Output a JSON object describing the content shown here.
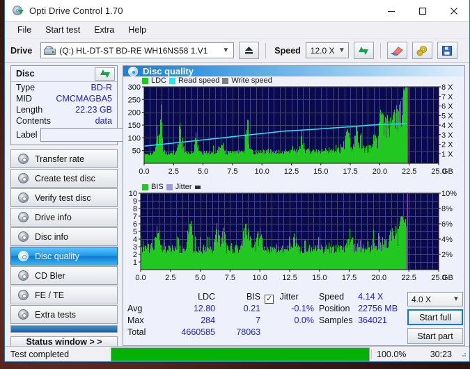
{
  "window": {
    "title": "Opti Drive Control 1.70",
    "app_icon": "disc-arrow-icon",
    "controls": {
      "minimize": "minimize-icon",
      "maximize": "maximize-icon",
      "close": "close-icon"
    }
  },
  "menu": {
    "items": [
      "File",
      "Start test",
      "Extra",
      "Help"
    ]
  },
  "toolbar": {
    "drive_label": "Drive",
    "drive_value": "(Q:)  HL-DT-ST BD-RE  WH16NS58 1.V1",
    "eject_icon": "eject-icon",
    "speed_label": "Speed",
    "speed_value": "12.0 X",
    "refresh_icon": "refresh-icon",
    "erase_icon": "eraser-icon",
    "settings_icon": "gear-icon",
    "save_icon": "save-icon"
  },
  "disc_panel": {
    "title": "Disc",
    "refresh_icon": "refresh-icon",
    "rows": [
      {
        "key": "Type",
        "value": "BD-R"
      },
      {
        "key": "MID",
        "value": "CMCMAGBA5"
      },
      {
        "key": "Length",
        "value": "22.23 GB"
      },
      {
        "key": "Contents",
        "value": "data"
      }
    ],
    "label_key": "Label",
    "label_value": "",
    "label_placeholder": "",
    "eject_disc_icon": "cd-icon"
  },
  "nav": {
    "items": [
      {
        "label": "Transfer rate",
        "icon": "disc-icon",
        "selected": false
      },
      {
        "label": "Create test disc",
        "icon": "disc-icon",
        "selected": false
      },
      {
        "label": "Verify test disc",
        "icon": "disc-icon",
        "selected": false
      },
      {
        "label": "Drive info",
        "icon": "disc-icon",
        "selected": false
      },
      {
        "label": "Disc info",
        "icon": "disc-icon",
        "selected": false
      },
      {
        "label": "Disc quality",
        "icon": "disc-icon",
        "selected": true
      },
      {
        "label": "CD Bler",
        "icon": "disc-icon",
        "selected": false
      },
      {
        "label": "FE / TE",
        "icon": "disc-icon",
        "selected": false
      },
      {
        "label": "Extra tests",
        "icon": "disc-icon",
        "selected": false
      }
    ],
    "status_window_button": "Status window > >"
  },
  "quality_panel": {
    "title": "Disc quality",
    "icon": "disc-icon"
  },
  "stats": {
    "col_headers": [
      "LDC",
      "BIS"
    ],
    "row_labels": [
      "Avg",
      "Max",
      "Total"
    ],
    "ldc": {
      "avg": "12.80",
      "max": "284",
      "total": "4660585"
    },
    "bis": {
      "avg": "0.21",
      "max": "7",
      "total": "78063"
    },
    "jitter": {
      "label": "Jitter",
      "checked": true,
      "check_glyph": "✓",
      "avg": "-0.1%",
      "max": "0.0%"
    },
    "speed_label": "Speed",
    "speed_value": "4.14 X",
    "position_label": "Position",
    "position_value": "22756 MB",
    "samples_label": "Samples",
    "samples_value": "364021",
    "result_speed": "4.0 X",
    "start_full": "Start full",
    "start_part": "Start part"
  },
  "statusbar": {
    "text": "Test completed",
    "progress_percent": 100.0,
    "progress_label": "100.0%",
    "elapsed": "30:23"
  },
  "colors": {
    "ldc_green": "#22c722",
    "read_speed_cyan": "#25e6f0",
    "write_speed_gray": "#808080",
    "bis_green": "#22c722",
    "jitter_lilac": "#9a9aea",
    "plot_bg": "#0a0a52",
    "grid": "#46466e",
    "marker_magenta": "#e020b0",
    "title_blue": "#1e7fd4",
    "value_blue": "#1c1ccc",
    "progress_green": "#06b006"
  },
  "chart_data": [
    {
      "type": "area",
      "name": "ldc-chart",
      "title": "",
      "xlabel": "GB",
      "ylabel": "LDC",
      "xlim": [
        0.0,
        25.0
      ],
      "ylim": [
        0,
        300
      ],
      "xticks": [
        "0.0",
        "2.5",
        "5.0",
        "7.5",
        "10.0",
        "12.5",
        "15.0",
        "17.5",
        "20.0",
        "22.5",
        "25.0"
      ],
      "yticks": [
        "50",
        "100",
        "150",
        "200",
        "250",
        "300"
      ],
      "y2ticks": [
        "1 X",
        "2 X",
        "3 X",
        "4 X",
        "5 X",
        "6 X",
        "7 X",
        "8 X"
      ],
      "y2lim": [
        0,
        8
      ],
      "grid": true,
      "legend": [
        {
          "name": "LDC",
          "color": "#22c722"
        },
        {
          "name": "Read speed",
          "color": "#25e6f0"
        },
        {
          "name": "Write speed",
          "color": "#808080"
        }
      ],
      "data_end_gb": 22.3,
      "series": [
        {
          "name": "LDC",
          "kind": "area",
          "x": [
            0.0,
            0.3,
            0.6,
            0.9,
            1.05,
            1.15,
            1.2,
            1.35,
            1.45,
            1.5,
            1.6,
            1.8,
            2.1,
            2.4,
            2.7,
            3.0,
            3.3,
            3.45,
            3.6,
            3.9,
            4.2,
            4.4,
            4.45,
            4.6,
            4.9,
            5.2,
            5.5,
            5.8,
            6.1,
            6.4,
            6.7,
            6.75,
            7.0,
            7.3,
            7.6,
            7.9,
            8.2,
            8.5,
            8.8,
            8.9,
            9.0,
            9.3,
            9.6,
            9.9,
            10.2,
            10.5,
            10.8,
            11.1,
            11.4,
            11.7,
            12.0,
            12.3,
            12.6,
            12.9,
            13.2,
            13.35,
            13.6,
            13.9,
            14.2,
            14.5,
            14.8,
            15.1,
            15.4,
            15.7,
            16.0,
            16.3,
            16.6,
            16.9,
            17.2,
            17.3,
            17.45,
            17.55,
            17.7,
            18.0,
            18.2,
            18.35,
            18.6,
            18.9,
            19.2,
            19.5,
            19.8,
            20.0,
            20.3,
            20.6,
            20.9,
            21.2,
            21.5,
            21.8,
            22.0,
            22.15,
            22.3
          ],
          "y": [
            38,
            40,
            42,
            45,
            160,
            95,
            80,
            205,
            243,
            120,
            70,
            48,
            45,
            44,
            46,
            163,
            48,
            45,
            47,
            45,
            46,
            182,
            70,
            48,
            46,
            45,
            47,
            48,
            50,
            48,
            100,
            52,
            49,
            47,
            46,
            48,
            50,
            52,
            196,
            90,
            55,
            50,
            49,
            48,
            50,
            52,
            50,
            49,
            51,
            50,
            52,
            53,
            50,
            52,
            55,
            133,
            50,
            52,
            54,
            53,
            52,
            53,
            55,
            58,
            60,
            62,
            58,
            60,
            140,
            120,
            130,
            65,
            62,
            155,
            70,
            120,
            68,
            66,
            70,
            120,
            90,
            210,
            190,
            175,
            180,
            195,
            215,
            250,
            280,
            300,
            300
          ]
        },
        {
          "name": "Read speed",
          "kind": "line",
          "color": "#25e6f0",
          "axis": "y2",
          "x": [
            0.0,
            2.0,
            4.0,
            6.0,
            8.0,
            10.0,
            12.0,
            14.0,
            16.0,
            17.5,
            19.0,
            20.0,
            21.0,
            22.0,
            22.3
          ],
          "y": [
            1.8,
            2.05,
            2.32,
            2.58,
            2.85,
            3.12,
            3.38,
            3.52,
            3.7,
            3.82,
            3.98,
            4.05,
            4.1,
            4.14,
            4.14
          ]
        }
      ]
    },
    {
      "type": "area",
      "name": "bis-chart",
      "title": "",
      "xlabel": "GB",
      "ylabel": "BIS",
      "xlim": [
        0.0,
        25.0
      ],
      "ylim": [
        0,
        10
      ],
      "xticks": [
        "0.0",
        "2.5",
        "5.0",
        "7.5",
        "10.0",
        "12.5",
        "15.0",
        "17.5",
        "20.0",
        "22.5",
        "25.0"
      ],
      "yticks": [
        "1",
        "2",
        "3",
        "4",
        "5",
        "6",
        "7",
        "8",
        "9",
        "10"
      ],
      "y2ticks": [
        "2%",
        "4%",
        "6%",
        "8%",
        "10%"
      ],
      "y2lim": [
        0,
        10
      ],
      "grid": true,
      "legend": [
        {
          "name": "BIS",
          "color": "#22c722"
        },
        {
          "name": "Jitter",
          "color": "#9a9aea"
        }
      ],
      "data_end_gb": 22.3,
      "series": [
        {
          "name": "BIS",
          "kind": "area",
          "x": [
            0.0,
            0.4,
            0.8,
            1.0,
            1.2,
            1.45,
            1.6,
            1.9,
            2.2,
            2.5,
            2.8,
            3.1,
            3.4,
            3.7,
            4.0,
            4.25,
            4.4,
            4.6,
            4.9,
            5.2,
            5.5,
            5.8,
            6.1,
            6.4,
            6.7,
            6.9,
            7.2,
            7.5,
            7.8,
            8.1,
            8.4,
            8.7,
            8.9,
            9.05,
            9.2,
            9.5,
            9.8,
            10.0,
            10.3,
            10.6,
            10.9,
            11.2,
            11.5,
            11.8,
            12.1,
            12.4,
            12.7,
            12.9,
            13.2,
            13.5,
            13.8,
            14.1,
            14.4,
            14.7,
            15.0,
            15.3,
            15.6,
            15.9,
            16.2,
            16.5,
            16.8,
            17.1,
            17.4,
            17.7,
            18.0,
            18.3,
            18.6,
            18.9,
            19.2,
            19.5,
            19.8,
            20.1,
            20.4,
            20.7,
            21.0,
            21.3,
            21.6,
            21.8,
            21.95,
            22.1,
            22.25,
            22.3
          ],
          "y": [
            3,
            4,
            3,
            4,
            4,
            7,
            3,
            3,
            3,
            3,
            3,
            3,
            3,
            3,
            6,
            6,
            3,
            3,
            3,
            3,
            3,
            3,
            3,
            6,
            3,
            6,
            3,
            3,
            3,
            3,
            3,
            6,
            6,
            5,
            5,
            3,
            5,
            5,
            3,
            3,
            3,
            3,
            3,
            3,
            3,
            4,
            4,
            5,
            3,
            3,
            3,
            3,
            3,
            3,
            4,
            3,
            4,
            3,
            3,
            3,
            3,
            3,
            4,
            4,
            3,
            4,
            3,
            3,
            3,
            4,
            4,
            4,
            4,
            4,
            5,
            6,
            5,
            7,
            7,
            6,
            7,
            7
          ]
        }
      ]
    }
  ]
}
